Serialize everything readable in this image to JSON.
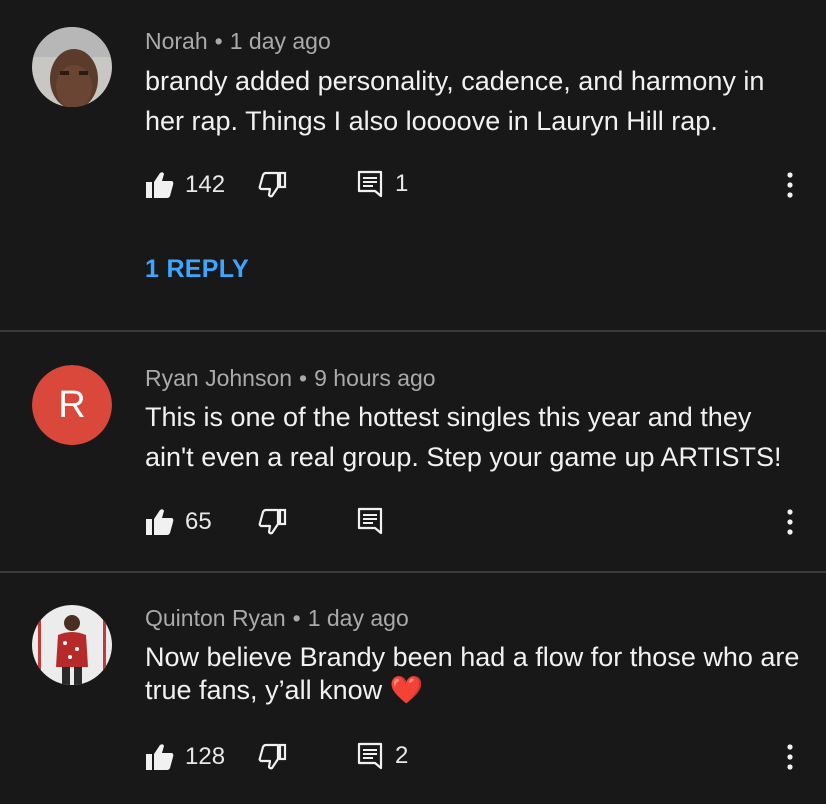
{
  "comments": [
    {
      "author": "Norah",
      "age": "1 day ago",
      "text": "brandy added personality, cadence, and harmony in her rap. Things I also loooove in Lauryn Hill rap.",
      "likes": "142",
      "replies": "1",
      "view_replies": "1 REPLY"
    },
    {
      "author": "Ryan Johnson",
      "age": "9 hours ago",
      "avatar_letter": "R",
      "avatar_color": "#d9483b",
      "text": "This is one of the hottest singles this year and they ain't even a real group. Step your game up ARTISTS!",
      "likes": "65"
    },
    {
      "author": "Quinton Ryan",
      "age": "1 day ago",
      "text": "Now believe Brandy been had a flow for those who are true fans, y’all know",
      "emoji": "❤️",
      "likes": "128",
      "replies": "2"
    }
  ],
  "separator": "•",
  "icons": {
    "like": "thumbs-up-icon",
    "dislike": "thumbs-down-icon",
    "reply": "comment-reply-icon",
    "menu": "more-vert-icon"
  }
}
